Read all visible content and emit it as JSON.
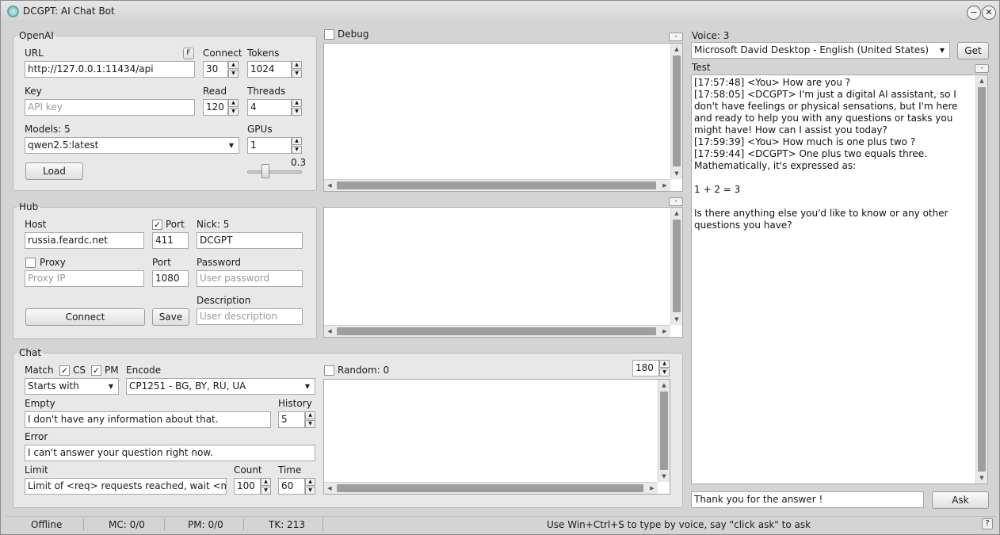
{
  "window": {
    "title": "DCGPT: AI Chat Bot",
    "minimize_symbol": "−",
    "close_symbol": "✕"
  },
  "openai": {
    "legend": "OpenAI",
    "url_label": "URL",
    "f_button": "F",
    "url_value": "http://127.0.0.1:11434/api",
    "connect_label": "Connect",
    "connect_value": "30",
    "tokens_label": "Tokens",
    "tokens_value": "1024",
    "key_label": "Key",
    "key_placeholder": "API key",
    "read_label": "Read",
    "read_value": "120",
    "threads_label": "Threads",
    "threads_value": "4",
    "models_label": "Models: 5",
    "model_value": "qwen2.5:latest",
    "gpus_label": "GPUs",
    "gpus_value": "1",
    "slider_value": "0.3",
    "load_button": "Load"
  },
  "debug": {
    "label": "Debug",
    "checked": false
  },
  "hub": {
    "legend": "Hub",
    "host_label": "Host",
    "host_value": "russia.feardc.net",
    "port_label": "Port",
    "port_value": "411",
    "nick_label": "Nick: 5",
    "nick_value": "DCGPT",
    "proxy_label": "Proxy",
    "proxy_placeholder": "Proxy IP",
    "proxy_port_label": "Port",
    "proxy_port_value": "1080",
    "password_label": "Password",
    "password_placeholder": "User password",
    "connect_button": "Connect",
    "save_button": "Save",
    "description_label": "Description",
    "description_placeholder": "User description"
  },
  "chat": {
    "legend": "Chat",
    "match_label": "Match",
    "cs_label": "CS",
    "pm_label": "PM",
    "encode_label": "Encode",
    "match_value": "Starts with",
    "encode_value": "CP1251 - BG, BY, RU, UA",
    "empty_label": "Empty",
    "empty_value": "I don't have any information about that.",
    "history_label": "History",
    "history_value": "5",
    "error_label": "Error",
    "error_value": "I can't answer your question right now.",
    "limit_label": "Limit",
    "limit_value": "Limit of <req> requests reached, wait <min> m",
    "count_label": "Count",
    "count_value": "100",
    "time_label": "Time",
    "time_value": "60",
    "random_label": "Random: 0",
    "random_value": "180"
  },
  "voice": {
    "label": "Voice: 3",
    "value": "Microsoft David Desktop - English (United States)",
    "get_button": "Get"
  },
  "test": {
    "label": "Test",
    "log": "[17:57:48] <You> How are you ?\n[17:58:05] <DCGPT> I'm just a digital AI assistant, so I don't have feelings or physical sensations, but I'm here and ready to help you with any questions or tasks you might have! How can I assist you today?\n[17:59:39] <You> How much is one plus two ?\n[17:59:44] <DCGPT> One plus two equals three. Mathematically, it's expressed as:\n\n1 + 2 = 3\n\nIs there anything else you'd like to know or any other questions you have?",
    "input_value": "Thank you for the answer !",
    "ask_button": "Ask"
  },
  "statusbar": {
    "state": "Offline",
    "mc": "MC: 0/0",
    "pm": "PM: 0/0",
    "tk": "TK: 213",
    "hint": "Use Win+Ctrl+S to type by voice, say \"click ask\" to ask",
    "help": "?"
  },
  "icons": {
    "spin_up": "▲",
    "spin_down": "▼",
    "combo_arrow": "▼",
    "check": "✓",
    "collapse": "-",
    "scroll_up": "▲",
    "scroll_down": "▼",
    "scroll_left": "◀",
    "scroll_right": "▶"
  }
}
